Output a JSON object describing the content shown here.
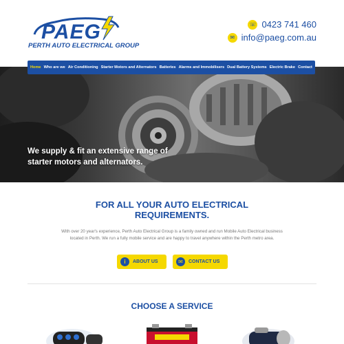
{
  "brand": {
    "logo_text": "PAEG",
    "logo_subtext": "PERTH AUTO ELECTRICAL GROUP"
  },
  "contact": {
    "phone": "0423 741 460",
    "email": "info@paeg.com.au",
    "phone_icon": "phone-icon",
    "email_icon": "mail-icon"
  },
  "nav": {
    "items": [
      {
        "label": "Home",
        "active": true
      },
      {
        "label": "Who are we"
      },
      {
        "label": "Air Conditioning"
      },
      {
        "label": "Starter Motors and Alternators"
      },
      {
        "label": "Batteries"
      },
      {
        "label": "Alarms and Immobilisers"
      },
      {
        "label": "Dual Battery Systems"
      },
      {
        "label": "Electric Brake"
      },
      {
        "label": "Contact"
      }
    ]
  },
  "hero": {
    "text": "We supply & fit an extensive range of starter motors and alternators."
  },
  "intro": {
    "title_line1": "FOR ALL YOUR AUTO ELECTRICAL",
    "title_line2": "REQUIREMENTS.",
    "body": "With over 20 year's experience, Perth Auto Electrical Group is a family owned and run Mobile Auto Electrical business located in Perth. We run a fully mobile service and are happy to travel anywhere within the Perth metro area."
  },
  "buttons": {
    "about_label": "ABOUT US",
    "contact_label": "CONTACT US",
    "about_icon": "info-icon",
    "contact_icon": "mail-icon"
  },
  "services": {
    "title": "CHOOSE A SERVICE"
  },
  "colors": {
    "brand_blue": "#1c4fa3",
    "accent_yellow": "#f5d800"
  }
}
